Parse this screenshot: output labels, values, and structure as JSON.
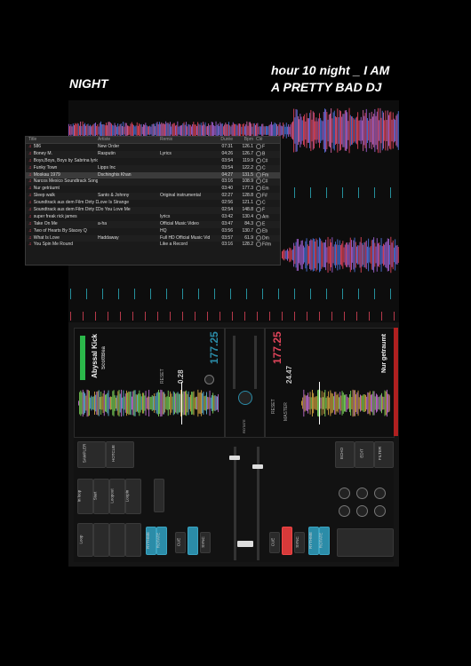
{
  "poster": {
    "left_title": "NIGHT",
    "right_line1": "hour 10 night  _ I AM",
    "right_line2": "A PRETTY BAD DJ"
  },
  "browser": {
    "headers": {
      "title": "Title",
      "artist": "Artiste",
      "remix": "Remix",
      "duration": "Durée",
      "bpm": "Bpm",
      "key": "Clé"
    },
    "tracks": [
      {
        "title": "586",
        "artist": "New Order",
        "remix": "",
        "duration": "07:31",
        "bpm": "126.1",
        "key": "F"
      },
      {
        "title": "Boney M.",
        "artist": "Rasputin",
        "remix": "Lyrics",
        "duration": "04:26",
        "bpm": "126.7",
        "key": "B"
      },
      {
        "title": "Boys,Boys, Boys by Sabrina lyrics",
        "artist": "",
        "remix": "",
        "duration": "03:54",
        "bpm": "119.9",
        "key": "C#"
      },
      {
        "title": "Funky Town",
        "artist": "Lipps Inc",
        "remix": "",
        "duration": "03:54",
        "bpm": "122.2",
        "key": "C"
      },
      {
        "title": "Moskau 1979",
        "artist": "Dschinghis Khan",
        "remix": "",
        "duration": "04:27",
        "bpm": "131.5",
        "key": "Fm"
      },
      {
        "title": "Narcos Mexico Soundtrack Song #14 Pr",
        "artist": "",
        "remix": "",
        "duration": "03:16",
        "bpm": "108.9",
        "key": "C#"
      },
      {
        "title": "Nur geträumt",
        "artist": "",
        "remix": "",
        "duration": "03:40",
        "bpm": "177.3",
        "key": "Em"
      },
      {
        "title": "Sleep walk",
        "artist": "Santo & Johnny",
        "remix": "Original instrumental",
        "duration": "02:27",
        "bpm": "128.8",
        "key": "F#"
      },
      {
        "title": "Soundtrack aus dem Film Dirty Dancing",
        "artist": "Love Is Strange",
        "remix": "",
        "duration": "02:56",
        "bpm": "121.1",
        "key": "C"
      },
      {
        "title": "Soundtrack aus dem Film Dirty Dancing",
        "artist": "Do You Love Me",
        "remix": "",
        "duration": "02:54",
        "bpm": "148.8",
        "key": "F"
      },
      {
        "title": "super freak rick james",
        "artist": "",
        "remix": "lyrics",
        "duration": "03:42",
        "bpm": "130.4",
        "key": "Am"
      },
      {
        "title": "Take On Me",
        "artist": "a-ha",
        "remix": "Official Music Video",
        "duration": "03:47",
        "bpm": "84.3",
        "key": "E"
      },
      {
        "title": "Two of Hearts By Stacey Q",
        "artist": "",
        "remix": "HQ",
        "duration": "03:56",
        "bpm": "130.7",
        "key": "Eb"
      },
      {
        "title": "What Is Love",
        "artist": "Haddaway",
        "remix": "Full HD Official Music Video",
        "duration": "03:57",
        "bpm": "61.9",
        "key": "Dm"
      },
      {
        "title": "You Spin Me Round",
        "artist": "",
        "remix": "Like a Record",
        "duration": "03:16",
        "bpm": "128.2",
        "key": "F#m"
      }
    ],
    "selected_index": 4
  },
  "deck_left": {
    "track_title": "Abyssal Kick",
    "artist": "ScottBea",
    "bpm": "177.25",
    "pitch": "0.28",
    "key_label": "Em",
    "reset": "RESET"
  },
  "deck_right": {
    "track_title": "Nur getraumt",
    "bpm": "177.25",
    "pitch": "24.47",
    "reset": "RESET",
    "master": "MASTER"
  },
  "controls": {
    "sampler": "SAMPLER",
    "hotcue": "HOTCUE",
    "in_loop": "In loop",
    "start": "Start",
    "loop_out": "Loopout",
    "loop_in": "Loopin",
    "loop": "Loop",
    "rythme": "RYTHME",
    "rotate": "ROTATE",
    "cue": "CUE",
    "sync": "SYNC",
    "echo": "ECHO",
    "edit": "EDIT",
    "filter": "FILTER"
  },
  "colors": {
    "wave_red": "#e0445a",
    "wave_blue": "#4a72d8",
    "accent_blue": "#2b8ca8",
    "accent_red": "#d63a3a",
    "deck_green": "#2bb84a"
  }
}
